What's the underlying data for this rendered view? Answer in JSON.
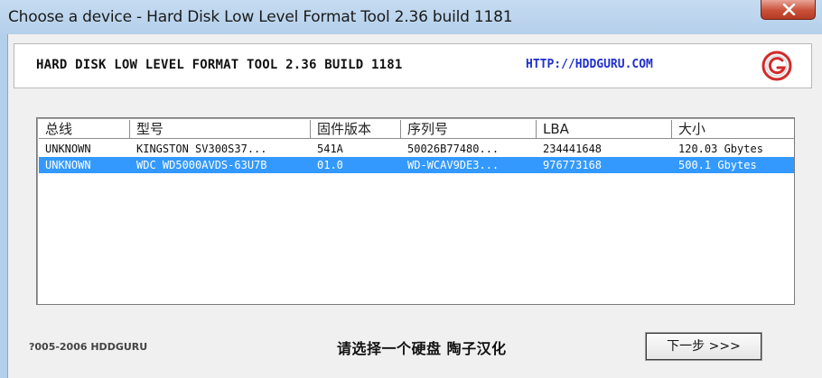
{
  "window": {
    "title": "Choose a device - Hard Disk Low Level Format Tool 2.36 build 1181"
  },
  "header": {
    "title": "HARD DISK LOW LEVEL FORMAT TOOL 2.36 BUILD 1181",
    "url": "HTTP://HDDGURU.COM",
    "logo_icon": "hddguru-logo-icon"
  },
  "device_list": {
    "columns": [
      "总线",
      "型号",
      "固件版本",
      "序列号",
      "LBA",
      "大小"
    ],
    "rows": [
      {
        "bus": "UNKNOWN",
        "model": "KINGSTON SV300S37...",
        "firmware": "541A",
        "serial": "50026B77480...",
        "lba": "234441648",
        "size": "120.03 Gbytes",
        "selected": false
      },
      {
        "bus": "UNKNOWN",
        "model": "WDC WD5000AVDS-63U7B",
        "firmware": "01.0",
        "serial": "WD-WCAV9DE3...",
        "lba": "976773168",
        "size": "500.1 Gbytes",
        "selected": true
      }
    ]
  },
  "footer": {
    "copyright": "?005-2006 HDDGURU",
    "credit": "请选择一个硬盘   陶子汉化",
    "next_label": "下一步 >>>"
  },
  "colors": {
    "selection": "#3399ff",
    "url": "#1f2fd0",
    "close_button": "#c9503a"
  }
}
